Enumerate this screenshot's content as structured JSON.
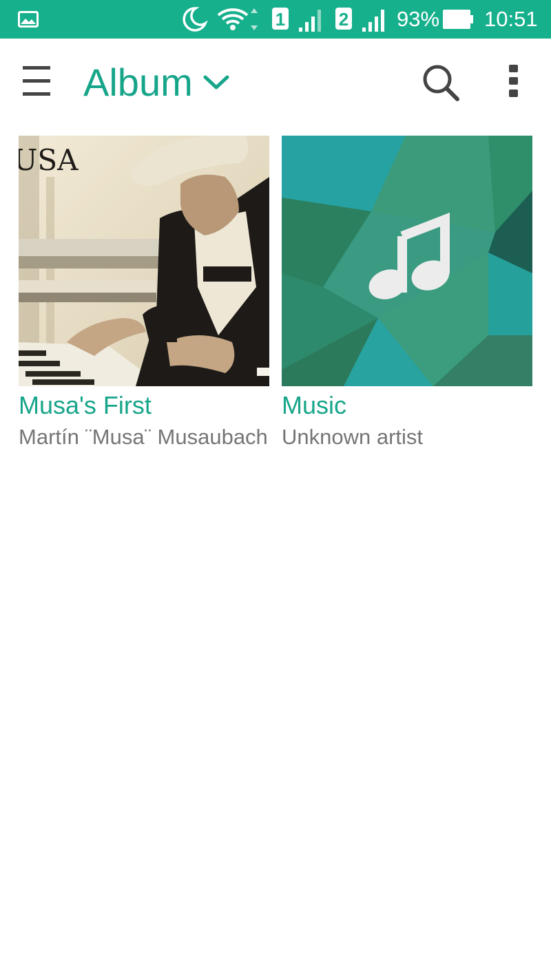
{
  "status_bar": {
    "icons": [
      "gallery-notification-icon",
      "moon-icon",
      "wifi-icon",
      "sim1-signal-icon",
      "sim2-signal-icon",
      "battery-icon"
    ],
    "sim1_label": "1",
    "sim2_label": "2",
    "battery_percent": "93%",
    "battery_level": 0.93,
    "time": "10:51",
    "color": "#17b08c"
  },
  "app_bar": {
    "title": "Album",
    "accent_color": "#17a58a",
    "icons": [
      "menu-icon",
      "chevron-down-icon",
      "search-icon",
      "more-vert-icon"
    ]
  },
  "albums": [
    {
      "title": "Musa's First",
      "artist": "Martín ¨Musa¨ Musaubach",
      "cover_text": "USA"
    },
    {
      "title": "Music",
      "artist": "Unknown artist",
      "cover_icon": "music-note-icon"
    }
  ]
}
